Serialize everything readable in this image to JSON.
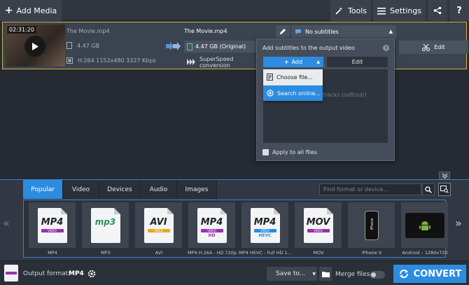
{
  "toolbar": {
    "add_media": "Add Media",
    "tools": "Tools",
    "settings": "Settings",
    "help": "?"
  },
  "file": {
    "timecode": "02:31:20",
    "source_name": "The Movie.mp4",
    "source_size": "4.47 GB",
    "source_info": "H.264 1152x480 3327 Kbps",
    "output_name": "The Movie.mp4",
    "output_size": "4.47 GB (Original)",
    "superspeed": "SuperSpeed conversion",
    "subtitles": "No subtitles",
    "edit": "Edit"
  },
  "subtitle_popup": {
    "title": "Add subtitles to the output video",
    "add": "Add",
    "edit": "Edit",
    "list_hint": "tracks (softsub)",
    "menu": [
      "Choose file...",
      "Search online..."
    ],
    "apply_all": "Apply to all files"
  },
  "tabs": [
    "Popular",
    "Video",
    "Devices",
    "Audio",
    "Images"
  ],
  "search": {
    "placeholder": "Find format or device..."
  },
  "formats": [
    {
      "main": "MP4",
      "bar": "VIDEO",
      "sub": "",
      "caption": "MP4",
      "bar_color": "#9b2fb0"
    },
    {
      "main": "mp3",
      "bar": "",
      "sub": "",
      "caption": "MP3",
      "bar_color": "#2f8f5a"
    },
    {
      "main": "AVI",
      "bar": "VIDEO",
      "sub": "",
      "caption": "AVI",
      "bar_color": "#e6a81e"
    },
    {
      "main": "MP4",
      "bar": "VIDEO",
      "sub": "HD",
      "caption": "MP4 H.264 - HD 720p",
      "bar_color": "#9b2fb0"
    },
    {
      "main": "MP4",
      "bar": "VIDEO",
      "sub": "HEVC",
      "caption": "MP4 HEVC - Full HD 1...",
      "bar_color": "#2b8ce0"
    },
    {
      "main": "MOV",
      "bar": "VIDEO",
      "sub": "",
      "caption": "MOV",
      "bar_color": "#9b2fb0"
    },
    {
      "main": "iPhone",
      "bar": "",
      "sub": "",
      "caption": "iPhone X",
      "bar_color": "#111111"
    },
    {
      "main": "Android",
      "bar": "",
      "sub": "",
      "caption": "Android – 1280x720",
      "bar_color": "#7cb342"
    }
  ],
  "bottom": {
    "output_label": "Output format:",
    "output_value": "MP4",
    "save_to": "Save to...",
    "merge": "Merge files:",
    "convert": "CONVERT"
  },
  "colors": {
    "accent": "#2b8ce0",
    "highlight_border": "#d4b345"
  }
}
